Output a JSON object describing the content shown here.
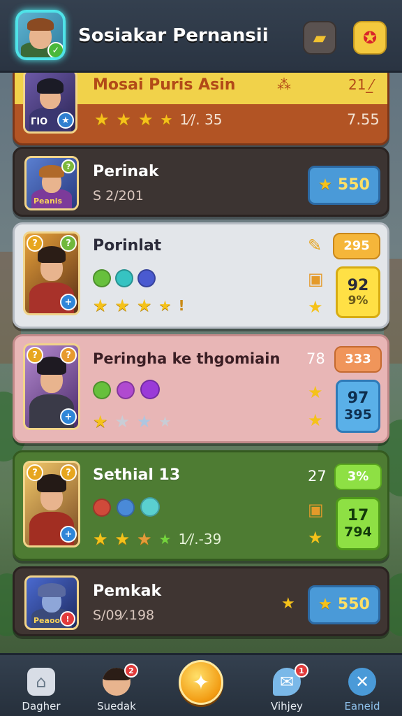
{
  "header": {
    "title": "Sosiakar Pernansii",
    "left_button_icon": "treasure-icon",
    "right_button_icon": "star-badge-icon"
  },
  "rows": [
    {
      "name": "Mosai Puris Asin",
      "portrait_label": "ΓΙΟ",
      "stars_text": "1⁄/. 35",
      "value_left": "⁂",
      "value_right": "21 ⁄̲",
      "value_bottom": "7.55",
      "stars": 4
    },
    {
      "name": "Perinak",
      "sub": "S 2/201",
      "portrait_label": "Peanis",
      "price": "550",
      "price_icon": "star-icon"
    },
    {
      "name": "Porinlat",
      "tail": "!",
      "top_pill": "295",
      "big_pill_top": "92",
      "big_pill_bottom": "9%",
      "stars": 4
    },
    {
      "name": "Peringha ke thgomiain",
      "side_value": "78",
      "top_pill": "333",
      "big_pill_top": "97",
      "big_pill_bottom": "395",
      "stars": 2
    },
    {
      "name": "Sethial 13",
      "side_value": "27",
      "top_pill": "3%",
      "big_pill_top": "17",
      "big_pill_bottom": "794",
      "stars_text": "1⁄/.-39",
      "stars": 3
    },
    {
      "name": "Pemkak",
      "sub": "S/09⁄.198",
      "portrait_label": "Peaoo",
      "price": "550",
      "price_icon": "star-icon"
    }
  ],
  "nav": [
    {
      "label": "Dagher",
      "icon": "home-icon"
    },
    {
      "label": "Suedak",
      "icon": "profile-icon",
      "badge": "2"
    },
    {
      "label": "",
      "icon": "center-reward-icon"
    },
    {
      "label": "Vihjey",
      "icon": "chat-icon",
      "badge": "1"
    },
    {
      "label": "Eaneid",
      "icon": "close-icon"
    }
  ],
  "colors": {
    "header_bg": "#34404f",
    "gold": "#f5c21a",
    "row1": "#b25424",
    "row3": "#e3e6ea",
    "row4": "#e8b6b6",
    "row5": "#4e7c33"
  }
}
